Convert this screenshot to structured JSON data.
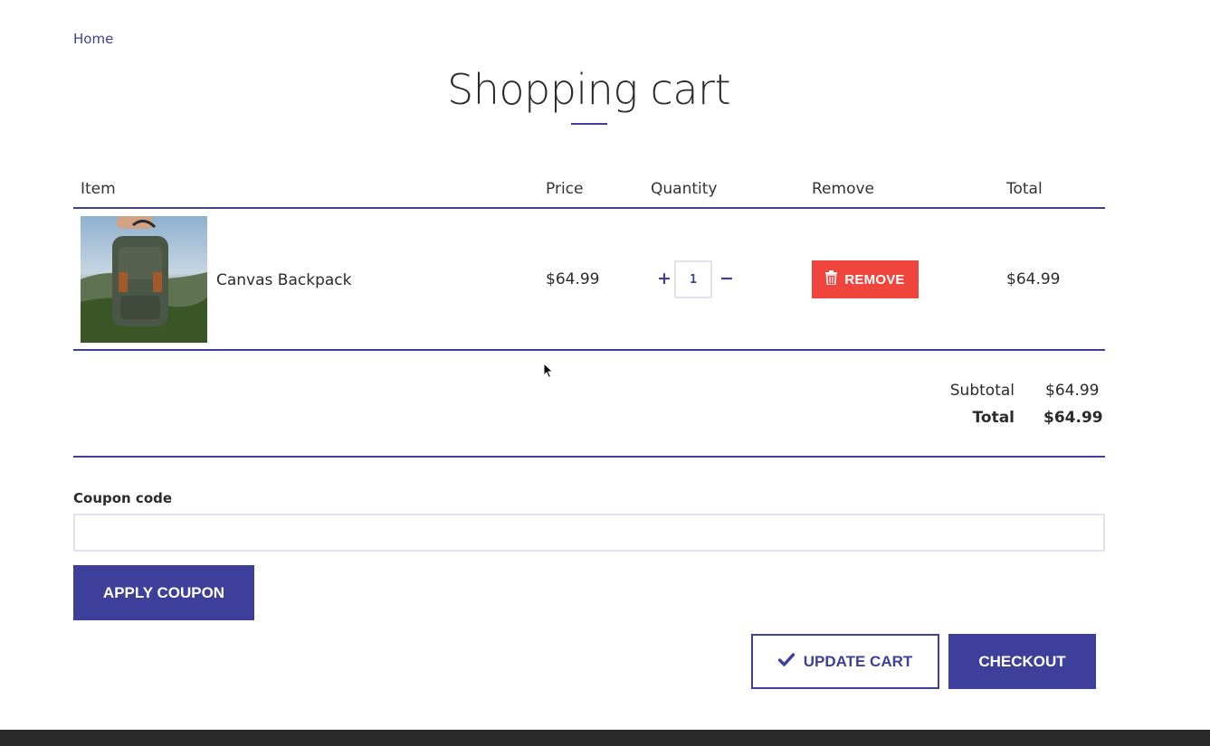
{
  "breadcrumb": {
    "home": "Home"
  },
  "page": {
    "title": "Shopping cart"
  },
  "table": {
    "headers": {
      "item": "Item",
      "price": "Price",
      "quantity": "Quantity",
      "remove": "Remove",
      "total": "Total"
    },
    "rows": [
      {
        "name": "Canvas Backpack",
        "price": "$64.99",
        "quantity": "1",
        "remove_label": "REMOVE",
        "total": "$64.99"
      }
    ],
    "quantity_increase": "+",
    "quantity_decrease": "−"
  },
  "summary": {
    "subtotal_label": "Subtotal",
    "subtotal_value": "$64.99",
    "total_label": "Total",
    "total_value": "$64.99"
  },
  "coupon": {
    "label": "Coupon code",
    "value": "",
    "apply_label": "APPLY COUPON"
  },
  "actions": {
    "update_label": "UPDATE CART",
    "checkout_label": "CHECKOUT"
  },
  "colors": {
    "accent": "#3d3f9a",
    "danger": "#f0453d",
    "footer": "#2a2a2a"
  },
  "icons": {
    "remove": "trash-icon",
    "update": "checkmark-icon"
  }
}
